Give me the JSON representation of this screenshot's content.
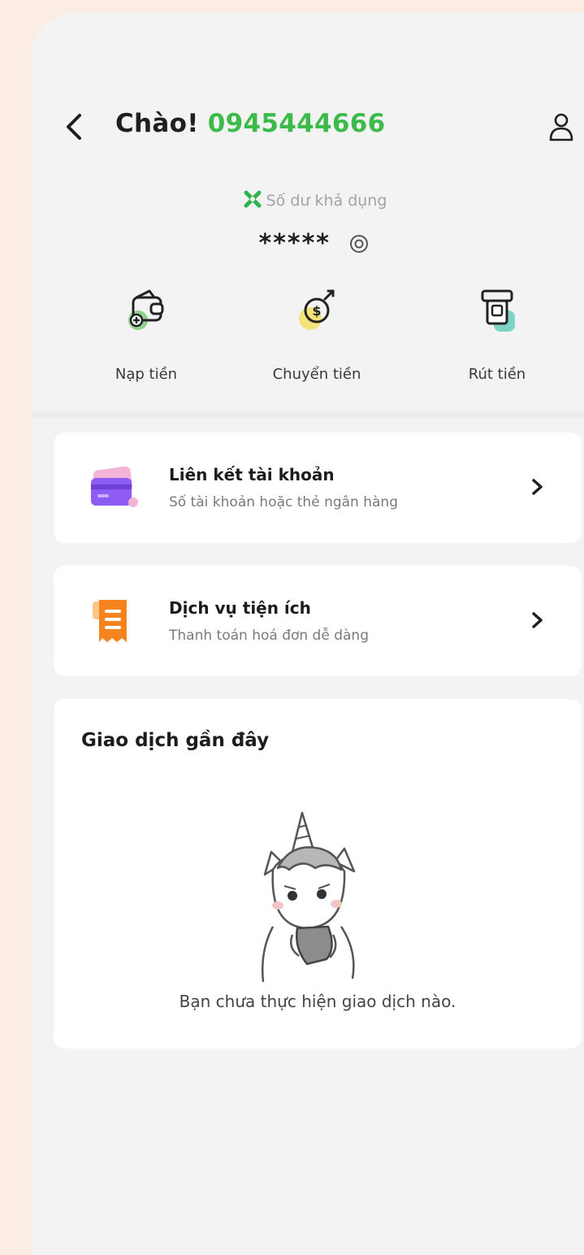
{
  "header": {
    "greeting_prefix": "Chào! ",
    "phone_number": "0945444666"
  },
  "balance": {
    "label": "Số dư khả dụng",
    "value": "*****"
  },
  "actions": [
    {
      "label": "Nạp tiền",
      "icon": "wallet-plus-icon"
    },
    {
      "label": "Chuyển tiền",
      "icon": "money-transfer-icon"
    },
    {
      "label": "Rút tiền",
      "icon": "atm-withdraw-icon"
    }
  ],
  "cards": {
    "link": {
      "title": "Liên kết tài khoản",
      "subtitle": "Số tài khoản hoặc thẻ ngân hàng",
      "icon": "bank-card-icon"
    },
    "service": {
      "title": "Dịch vụ tiện ích",
      "subtitle": "Thanh toán hoá đơn dễ dàng",
      "icon": "receipt-icon"
    }
  },
  "recent": {
    "title": "Giao dịch gần đây",
    "empty_text": "Bạn chưa thực hiện giao dịch nào."
  },
  "colors": {
    "accent_green": "#3dbb4a",
    "page_bg": "#fbede4",
    "screen_bg": "#f3f3f3",
    "card_purple": "#8e5cf2",
    "service_orange": "#f5841f"
  }
}
